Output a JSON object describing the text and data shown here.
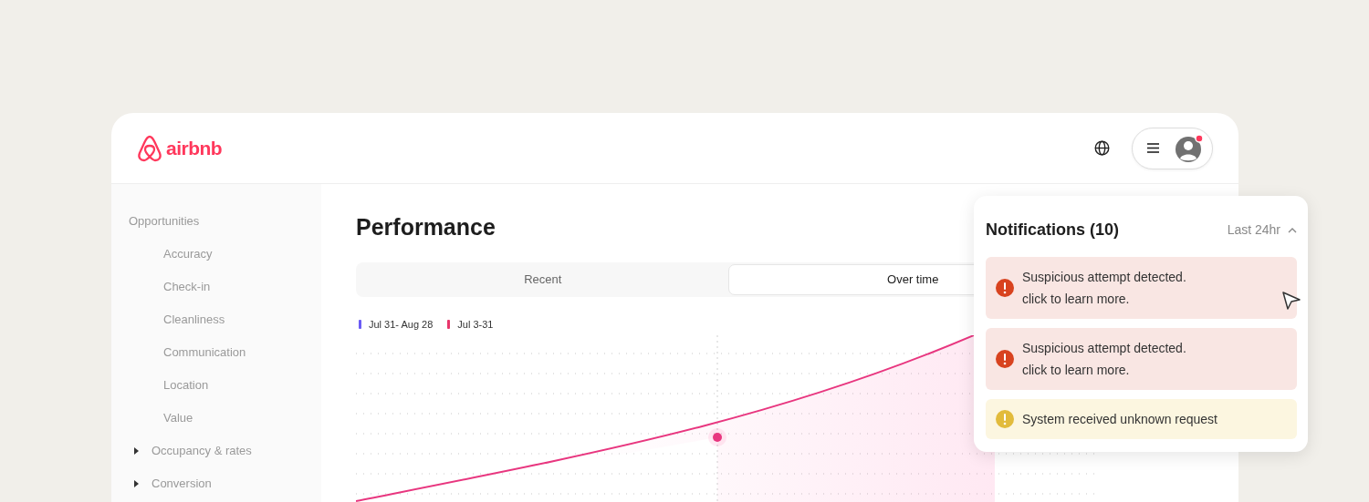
{
  "header": {
    "logo_text": "airbnb"
  },
  "sidebar": {
    "items": [
      {
        "label": "Opportunities",
        "expanded": true,
        "children": [
          {
            "label": "Accuracy"
          },
          {
            "label": "Check-in"
          },
          {
            "label": "Cleanliness"
          },
          {
            "label": "Communication"
          },
          {
            "label": "Location"
          },
          {
            "label": "Value"
          }
        ]
      },
      {
        "label": "Occupancy & rates",
        "expanded": false
      },
      {
        "label": "Conversion",
        "expanded": false
      }
    ]
  },
  "main": {
    "title": "Performance",
    "tabs": [
      {
        "label": "Recent",
        "selected": false
      },
      {
        "label": "Over time",
        "selected": true
      }
    ],
    "chart": {
      "legend": [
        {
          "label": "Jul 31- Aug 28",
          "color": "#6b5cf5"
        },
        {
          "label": "Jul 3-31",
          "color": "#e8366b"
        }
      ]
    }
  },
  "notifications": {
    "title": "Notifications (10)",
    "filter": "Last 24hr",
    "items": [
      {
        "kind": "error",
        "text": "Suspicious attempt detected.",
        "detail": "click to learn more."
      },
      {
        "kind": "error",
        "text": "Suspicious attempt detected.",
        "detail": "click to learn more."
      },
      {
        "kind": "warning",
        "text": "System received unknown request"
      }
    ]
  }
}
